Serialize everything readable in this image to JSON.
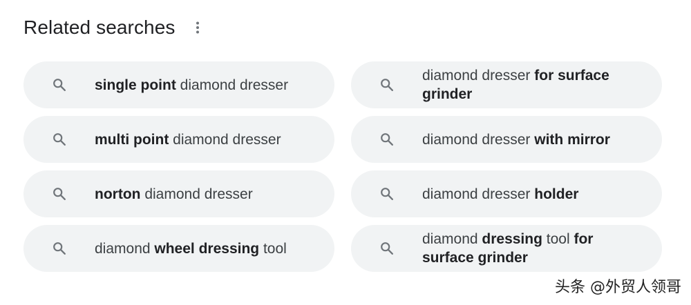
{
  "header": {
    "title": "Related searches",
    "more_icon": "more-vert-icon"
  },
  "searches": [
    {
      "parts": [
        {
          "t": "single point",
          "b": true
        },
        {
          "t": " diamond dresser",
          "b": false
        }
      ]
    },
    {
      "parts": [
        {
          "t": "diamond dresser ",
          "b": false
        },
        {
          "t": "for surface grinder",
          "b": true
        }
      ]
    },
    {
      "parts": [
        {
          "t": "multi point",
          "b": true
        },
        {
          "t": " diamond dresser",
          "b": false
        }
      ]
    },
    {
      "parts": [
        {
          "t": "diamond dresser ",
          "b": false
        },
        {
          "t": "with mirror",
          "b": true
        }
      ]
    },
    {
      "parts": [
        {
          "t": "norton",
          "b": true
        },
        {
          "t": " diamond dresser",
          "b": false
        }
      ]
    },
    {
      "parts": [
        {
          "t": "diamond dresser ",
          "b": false
        },
        {
          "t": "holder",
          "b": true
        }
      ]
    },
    {
      "parts": [
        {
          "t": "diamond ",
          "b": false
        },
        {
          "t": "wheel dressing",
          "b": true
        },
        {
          "t": " tool",
          "b": false
        }
      ]
    },
    {
      "parts": [
        {
          "t": "diamond ",
          "b": false
        },
        {
          "t": "dressing",
          "b": true
        },
        {
          "t": " tool ",
          "b": false
        },
        {
          "t": "for surface grinder",
          "b": true
        }
      ]
    }
  ],
  "search_icon": "search-icon",
  "watermark": "头条 @外贸人领哥",
  "colors": {
    "chip_bg": "#f1f3f4",
    "text": "#3c4043",
    "icon": "#70757a"
  }
}
